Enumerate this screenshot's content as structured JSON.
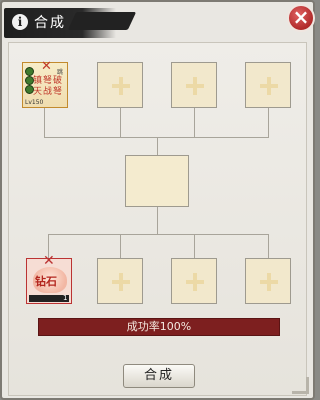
{
  "window": {
    "title": "合成",
    "info_icon_char": "i",
    "close_char": "×"
  },
  "main_item": {
    "icon": "bow-item-icon",
    "tag": "跳",
    "text_line1": "镇弩破",
    "text_line2": "天战弩",
    "level": "Lv150"
  },
  "material": {
    "icon": "stone-bag-icon",
    "name": "钻石",
    "count": "1"
  },
  "progress": {
    "label": "成功率100%",
    "value_percent": 100
  },
  "buttons": {
    "craft_label": "合成"
  },
  "colors": {
    "close": "#c13a3a",
    "progress_fill": "#7d1f1f",
    "slot_bg": "#f2e8cc"
  }
}
